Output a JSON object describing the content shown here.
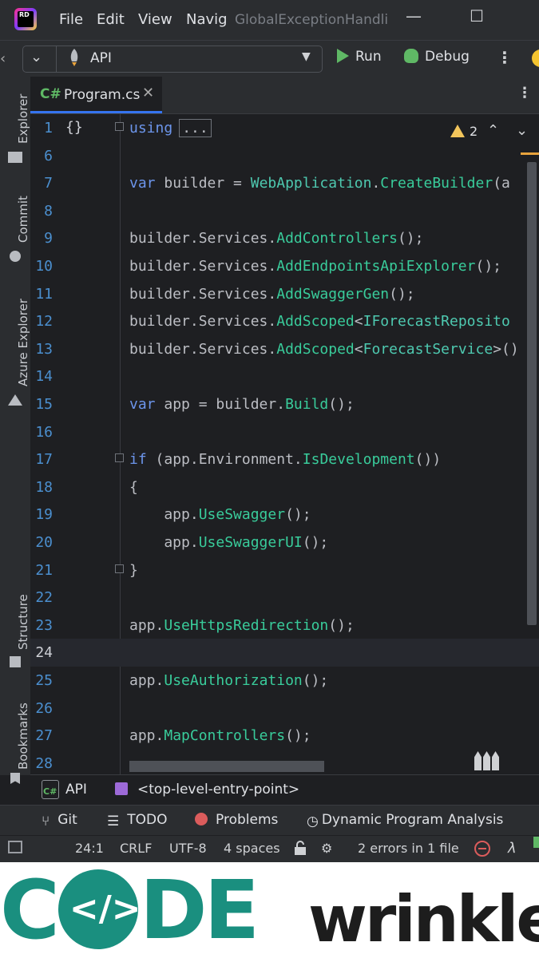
{
  "titlebar": {
    "logo_text": "RD",
    "menu": [
      "File",
      "Edit",
      "View",
      "Navig"
    ],
    "window_title": "GlobalExceptionHandli",
    "minimize": "—",
    "maximize": "☐"
  },
  "toolbar": {
    "config_name": "API",
    "run_label": "Run",
    "debug_label": "Debug"
  },
  "sidebar": {
    "items": [
      "Explorer",
      "Commit",
      "Azure Explorer",
      "Structure",
      "Bookmarks"
    ]
  },
  "tab": {
    "lang": "C#",
    "file_name": "Program.cs"
  },
  "editor": {
    "warnings_count": "2",
    "lines": [
      {
        "n": "1"
      },
      {
        "n": "6"
      },
      {
        "n": "7"
      },
      {
        "n": "8"
      },
      {
        "n": "9"
      },
      {
        "n": "10"
      },
      {
        "n": "11"
      },
      {
        "n": "12"
      },
      {
        "n": "13"
      },
      {
        "n": "14"
      },
      {
        "n": "15"
      },
      {
        "n": "16"
      },
      {
        "n": "17"
      },
      {
        "n": "18"
      },
      {
        "n": "19"
      },
      {
        "n": "20"
      },
      {
        "n": "21"
      },
      {
        "n": "22"
      },
      {
        "n": "23"
      },
      {
        "n": "24"
      },
      {
        "n": "25"
      },
      {
        "n": "26"
      },
      {
        "n": "27"
      },
      {
        "n": "28"
      }
    ],
    "code": {
      "l1_kw": "using",
      "l1_dots": "...",
      "l7_var": "var",
      "l7_builder": " builder = ",
      "l7_cls": "WebApplication",
      "l7_dot": ".",
      "l7_m": "CreateBuilder",
      "l7_rest": "(a",
      "l9_b": "builder.Services.",
      "l9_m": "AddControllers",
      "l9_r": "();",
      "l10_b": "builder.Services.",
      "l10_m": "AddEndpointsApiExplorer",
      "l10_r": "();",
      "l11_b": "builder.Services.",
      "l11_m": "AddSwaggerGen",
      "l11_r": "();",
      "l12_b": "builder.Services.",
      "l12_m": "AddScoped",
      "l12_lt": "<",
      "l12_c": "IForecastReposito",
      "l13_b": "builder.Services.",
      "l13_m": "AddScoped",
      "l13_lt": "<",
      "l13_c": "ForecastService",
      "l13_r": ">()",
      "l15_var": "var",
      "l15_a": " app = builder.",
      "l15_m": "Build",
      "l15_r": "();",
      "l17_if": "if",
      "l17_a": " (app.Environment.",
      "l17_m": "IsDevelopment",
      "l17_r": "())",
      "l18": "{",
      "l19_a": "    app.",
      "l19_m": "UseSwagger",
      "l19_r": "();",
      "l20_a": "    app.",
      "l20_m": "UseSwaggerUI",
      "l20_r": "();",
      "l21": "}",
      "l23_a": "app.",
      "l23_m": "UseHttpsRedirection",
      "l23_r": "();",
      "l25_a": "app.",
      "l25_m": "UseAuthorization",
      "l25_r": "();",
      "l27_a": "app.",
      "l27_m": "MapControllers",
      "l27_r": "();"
    }
  },
  "breadcrumb": {
    "project": "API",
    "entry": "<top-level-entry-point>"
  },
  "tool_tabs": [
    "Git",
    "TODO",
    "Problems",
    "Dynamic Program Analysis"
  ],
  "status": {
    "position": "24:1",
    "line_endings": "CRLF",
    "encoding": "UTF-8",
    "indent": "4 spaces",
    "errors": "2 errors in 1 file"
  },
  "banner": {
    "part1": "C",
    "part1b": "DE",
    "part2": "wrinkles",
    "o_glyph": "</>"
  },
  "colors": {
    "accent_blue": "#3574f0",
    "run_green": "#5fb865",
    "warning_yellow": "#f2c55c",
    "error_red": "#db5c5c",
    "brand_teal": "#1a8f7f"
  }
}
